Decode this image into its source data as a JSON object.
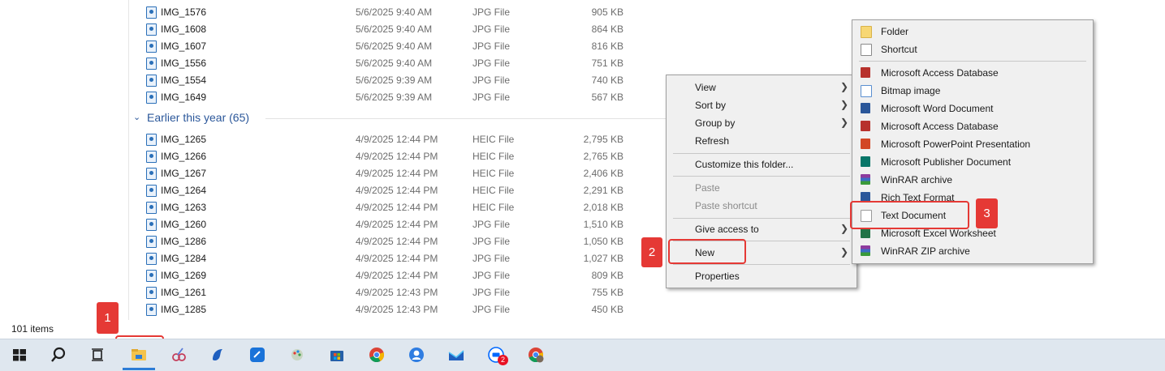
{
  "files_recent": [
    {
      "name": "IMG_1576",
      "date": "5/6/2025 9:40 AM",
      "type": "JPG File",
      "size": "905 KB"
    },
    {
      "name": "IMG_1608",
      "date": "5/6/2025 9:40 AM",
      "type": "JPG File",
      "size": "864 KB"
    },
    {
      "name": "IMG_1607",
      "date": "5/6/2025 9:40 AM",
      "type": "JPG File",
      "size": "816 KB"
    },
    {
      "name": "IMG_1556",
      "date": "5/6/2025 9:40 AM",
      "type": "JPG File",
      "size": "751 KB"
    },
    {
      "name": "IMG_1554",
      "date": "5/6/2025 9:39 AM",
      "type": "JPG File",
      "size": "740 KB"
    },
    {
      "name": "IMG_1649",
      "date": "5/6/2025 9:39 AM",
      "type": "JPG File",
      "size": "567 KB"
    }
  ],
  "group_header": {
    "label": "Earlier this year (65)"
  },
  "files_earlier": [
    {
      "name": "IMG_1265",
      "date": "4/9/2025 12:44 PM",
      "type": "HEIC File",
      "size": "2,795 KB"
    },
    {
      "name": "IMG_1266",
      "date": "4/9/2025 12:44 PM",
      "type": "HEIC File",
      "size": "2,765 KB"
    },
    {
      "name": "IMG_1267",
      "date": "4/9/2025 12:44 PM",
      "type": "HEIC File",
      "size": "2,406 KB"
    },
    {
      "name": "IMG_1264",
      "date": "4/9/2025 12:44 PM",
      "type": "HEIC File",
      "size": "2,291 KB"
    },
    {
      "name": "IMG_1263",
      "date": "4/9/2025 12:44 PM",
      "type": "HEIC File",
      "size": "2,018 KB"
    },
    {
      "name": "IMG_1260",
      "date": "4/9/2025 12:44 PM",
      "type": "JPG File",
      "size": "1,510 KB"
    },
    {
      "name": "IMG_1286",
      "date": "4/9/2025 12:44 PM",
      "type": "JPG File",
      "size": "1,050 KB"
    },
    {
      "name": "IMG_1284",
      "date": "4/9/2025 12:44 PM",
      "type": "JPG File",
      "size": "1,027 KB"
    },
    {
      "name": "IMG_1269",
      "date": "4/9/2025 12:44 PM",
      "type": "JPG File",
      "size": "809 KB"
    },
    {
      "name": "IMG_1261",
      "date": "4/9/2025 12:43 PM",
      "type": "JPG File",
      "size": "755 KB"
    },
    {
      "name": "IMG_1285",
      "date": "4/9/2025 12:43 PM",
      "type": "JPG File",
      "size": "450 KB"
    }
  ],
  "status_bar": {
    "items_count": "101 items"
  },
  "context_menu": {
    "view": "View",
    "sort_by": "Sort by",
    "group_by": "Group by",
    "refresh": "Refresh",
    "customize": "Customize this folder...",
    "paste": "Paste",
    "paste_shortcut": "Paste shortcut",
    "give_access": "Give access to",
    "new": "New",
    "properties": "Properties"
  },
  "new_submenu": {
    "folder": "Folder",
    "shortcut": "Shortcut",
    "items": [
      {
        "label": "Microsoft Access Database",
        "icon": "access-icon"
      },
      {
        "label": "Bitmap image",
        "icon": "bitmap-icon"
      },
      {
        "label": "Microsoft Word Document",
        "icon": "word-icon"
      },
      {
        "label": "Microsoft Access Database",
        "icon": "access-icon"
      },
      {
        "label": "Microsoft PowerPoint Presentation",
        "icon": "powerpoint-icon"
      },
      {
        "label": "Microsoft Publisher Document",
        "icon": "publisher-icon"
      },
      {
        "label": "WinRAR archive",
        "icon": "winrar-icon"
      },
      {
        "label": "Rich Text Format",
        "icon": "rtf-icon"
      },
      {
        "label": "Text Document",
        "icon": "text-document-icon"
      },
      {
        "label": "Microsoft Excel Worksheet",
        "icon": "excel-icon"
      },
      {
        "label": "WinRAR ZIP archive",
        "icon": "winrar-zip-icon"
      }
    ]
  },
  "annotations": {
    "step1": "1",
    "step2": "2",
    "step3": "3"
  },
  "taskbar": {
    "zalo_badge": "2"
  },
  "colors": {
    "highlight": "#e53935",
    "menu_bg": "#f0f0f0",
    "group_header": "#2b579a",
    "taskbar_bg": "#dfe7ef"
  }
}
